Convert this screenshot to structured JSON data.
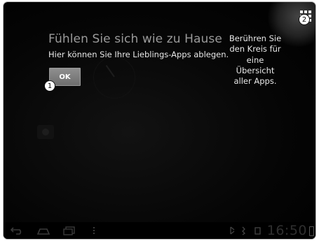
{
  "dialog": {
    "title": "Fühlen Sie sich wie zu Hause",
    "subtitle": "Hier können Sie Ihre Lieblings-Apps ablegen.",
    "ok_label": "OK"
  },
  "apps_hint": {
    "lines": [
      "Berühren Sie",
      "den Kreis für",
      "eine",
      "Übersicht",
      "aller Apps."
    ]
  },
  "markers": [
    "1",
    "2"
  ],
  "statusbar": {
    "time": "16:50"
  },
  "icons": {
    "apps": "apps-grid-icon",
    "back": "back-icon",
    "home": "home-icon",
    "recent": "recent-apps-icon",
    "menu": "menu-icon"
  },
  "colors": {
    "background": "#000000",
    "ok_button": "#7d7d7d",
    "title_text": "#9a9a9a"
  }
}
